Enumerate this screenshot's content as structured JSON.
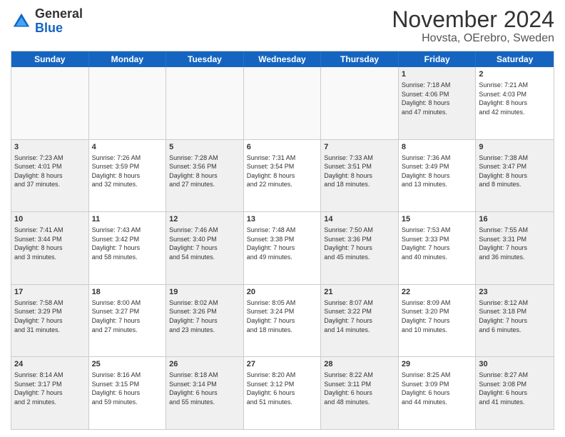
{
  "logo": {
    "general": "General",
    "blue": "Blue"
  },
  "title": "November 2024",
  "location": "Hovsta, OErebro, Sweden",
  "days": [
    "Sunday",
    "Monday",
    "Tuesday",
    "Wednesday",
    "Thursday",
    "Friday",
    "Saturday"
  ],
  "rows": [
    [
      {
        "day": "",
        "info": "",
        "empty": true
      },
      {
        "day": "",
        "info": "",
        "empty": true
      },
      {
        "day": "",
        "info": "",
        "empty": true
      },
      {
        "day": "",
        "info": "",
        "empty": true
      },
      {
        "day": "",
        "info": "",
        "empty": true
      },
      {
        "day": "1",
        "info": "Sunrise: 7:18 AM\nSunset: 4:06 PM\nDaylight: 8 hours\nand 47 minutes.",
        "empty": false,
        "shaded": true
      },
      {
        "day": "2",
        "info": "Sunrise: 7:21 AM\nSunset: 4:03 PM\nDaylight: 8 hours\nand 42 minutes.",
        "empty": false,
        "shaded": false
      }
    ],
    [
      {
        "day": "3",
        "info": "Sunrise: 7:23 AM\nSunset: 4:01 PM\nDaylight: 8 hours\nand 37 minutes.",
        "empty": false,
        "shaded": true
      },
      {
        "day": "4",
        "info": "Sunrise: 7:26 AM\nSunset: 3:59 PM\nDaylight: 8 hours\nand 32 minutes.",
        "empty": false,
        "shaded": false
      },
      {
        "day": "5",
        "info": "Sunrise: 7:28 AM\nSunset: 3:56 PM\nDaylight: 8 hours\nand 27 minutes.",
        "empty": false,
        "shaded": true
      },
      {
        "day": "6",
        "info": "Sunrise: 7:31 AM\nSunset: 3:54 PM\nDaylight: 8 hours\nand 22 minutes.",
        "empty": false,
        "shaded": false
      },
      {
        "day": "7",
        "info": "Sunrise: 7:33 AM\nSunset: 3:51 PM\nDaylight: 8 hours\nand 18 minutes.",
        "empty": false,
        "shaded": true
      },
      {
        "day": "8",
        "info": "Sunrise: 7:36 AM\nSunset: 3:49 PM\nDaylight: 8 hours\nand 13 minutes.",
        "empty": false,
        "shaded": false
      },
      {
        "day": "9",
        "info": "Sunrise: 7:38 AM\nSunset: 3:47 PM\nDaylight: 8 hours\nand 8 minutes.",
        "empty": false,
        "shaded": true
      }
    ],
    [
      {
        "day": "10",
        "info": "Sunrise: 7:41 AM\nSunset: 3:44 PM\nDaylight: 8 hours\nand 3 minutes.",
        "empty": false,
        "shaded": true
      },
      {
        "day": "11",
        "info": "Sunrise: 7:43 AM\nSunset: 3:42 PM\nDaylight: 7 hours\nand 58 minutes.",
        "empty": false,
        "shaded": false
      },
      {
        "day": "12",
        "info": "Sunrise: 7:46 AM\nSunset: 3:40 PM\nDaylight: 7 hours\nand 54 minutes.",
        "empty": false,
        "shaded": true
      },
      {
        "day": "13",
        "info": "Sunrise: 7:48 AM\nSunset: 3:38 PM\nDaylight: 7 hours\nand 49 minutes.",
        "empty": false,
        "shaded": false
      },
      {
        "day": "14",
        "info": "Sunrise: 7:50 AM\nSunset: 3:36 PM\nDaylight: 7 hours\nand 45 minutes.",
        "empty": false,
        "shaded": true
      },
      {
        "day": "15",
        "info": "Sunrise: 7:53 AM\nSunset: 3:33 PM\nDaylight: 7 hours\nand 40 minutes.",
        "empty": false,
        "shaded": false
      },
      {
        "day": "16",
        "info": "Sunrise: 7:55 AM\nSunset: 3:31 PM\nDaylight: 7 hours\nand 36 minutes.",
        "empty": false,
        "shaded": true
      }
    ],
    [
      {
        "day": "17",
        "info": "Sunrise: 7:58 AM\nSunset: 3:29 PM\nDaylight: 7 hours\nand 31 minutes.",
        "empty": false,
        "shaded": true
      },
      {
        "day": "18",
        "info": "Sunrise: 8:00 AM\nSunset: 3:27 PM\nDaylight: 7 hours\nand 27 minutes.",
        "empty": false,
        "shaded": false
      },
      {
        "day": "19",
        "info": "Sunrise: 8:02 AM\nSunset: 3:26 PM\nDaylight: 7 hours\nand 23 minutes.",
        "empty": false,
        "shaded": true
      },
      {
        "day": "20",
        "info": "Sunrise: 8:05 AM\nSunset: 3:24 PM\nDaylight: 7 hours\nand 18 minutes.",
        "empty": false,
        "shaded": false
      },
      {
        "day": "21",
        "info": "Sunrise: 8:07 AM\nSunset: 3:22 PM\nDaylight: 7 hours\nand 14 minutes.",
        "empty": false,
        "shaded": true
      },
      {
        "day": "22",
        "info": "Sunrise: 8:09 AM\nSunset: 3:20 PM\nDaylight: 7 hours\nand 10 minutes.",
        "empty": false,
        "shaded": false
      },
      {
        "day": "23",
        "info": "Sunrise: 8:12 AM\nSunset: 3:18 PM\nDaylight: 7 hours\nand 6 minutes.",
        "empty": false,
        "shaded": true
      }
    ],
    [
      {
        "day": "24",
        "info": "Sunrise: 8:14 AM\nSunset: 3:17 PM\nDaylight: 7 hours\nand 2 minutes.",
        "empty": false,
        "shaded": true
      },
      {
        "day": "25",
        "info": "Sunrise: 8:16 AM\nSunset: 3:15 PM\nDaylight: 6 hours\nand 59 minutes.",
        "empty": false,
        "shaded": false
      },
      {
        "day": "26",
        "info": "Sunrise: 8:18 AM\nSunset: 3:14 PM\nDaylight: 6 hours\nand 55 minutes.",
        "empty": false,
        "shaded": true
      },
      {
        "day": "27",
        "info": "Sunrise: 8:20 AM\nSunset: 3:12 PM\nDaylight: 6 hours\nand 51 minutes.",
        "empty": false,
        "shaded": false
      },
      {
        "day": "28",
        "info": "Sunrise: 8:22 AM\nSunset: 3:11 PM\nDaylight: 6 hours\nand 48 minutes.",
        "empty": false,
        "shaded": true
      },
      {
        "day": "29",
        "info": "Sunrise: 8:25 AM\nSunset: 3:09 PM\nDaylight: 6 hours\nand 44 minutes.",
        "empty": false,
        "shaded": false
      },
      {
        "day": "30",
        "info": "Sunrise: 8:27 AM\nSunset: 3:08 PM\nDaylight: 6 hours\nand 41 minutes.",
        "empty": false,
        "shaded": true
      }
    ]
  ]
}
